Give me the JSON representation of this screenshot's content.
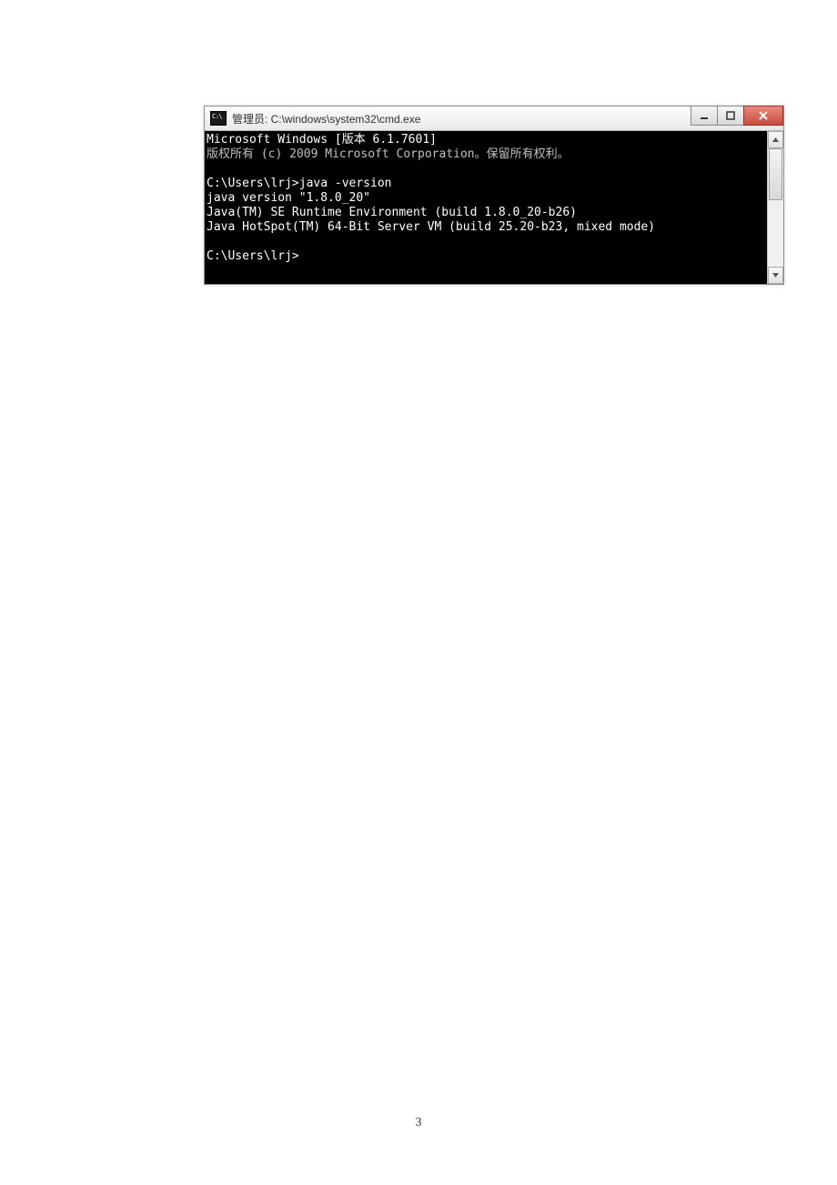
{
  "window": {
    "title": "管理员: C:\\windows\\system32\\cmd.exe"
  },
  "terminal": {
    "lines": [
      {
        "cls": "bright",
        "text": "Microsoft Windows [版本 6.1.7601]"
      },
      {
        "cls": "",
        "text": "版权所有 (c) 2009 Microsoft Corporation。保留所有权利。"
      },
      {
        "cls": "",
        "text": ""
      },
      {
        "cls": "bright",
        "text": "C:\\Users\\lrj>java -version"
      },
      {
        "cls": "bright",
        "text": "java version \"1.8.0_20\""
      },
      {
        "cls": "bright",
        "text": "Java(TM) SE Runtime Environment (build 1.8.0_20-b26)"
      },
      {
        "cls": "bright",
        "text": "Java HotSpot(TM) 64-Bit Server VM (build 25.20-b23, mixed mode)"
      },
      {
        "cls": "",
        "text": ""
      },
      {
        "cls": "bright",
        "text": "C:\\Users\\lrj>"
      }
    ]
  },
  "page_number": "3"
}
